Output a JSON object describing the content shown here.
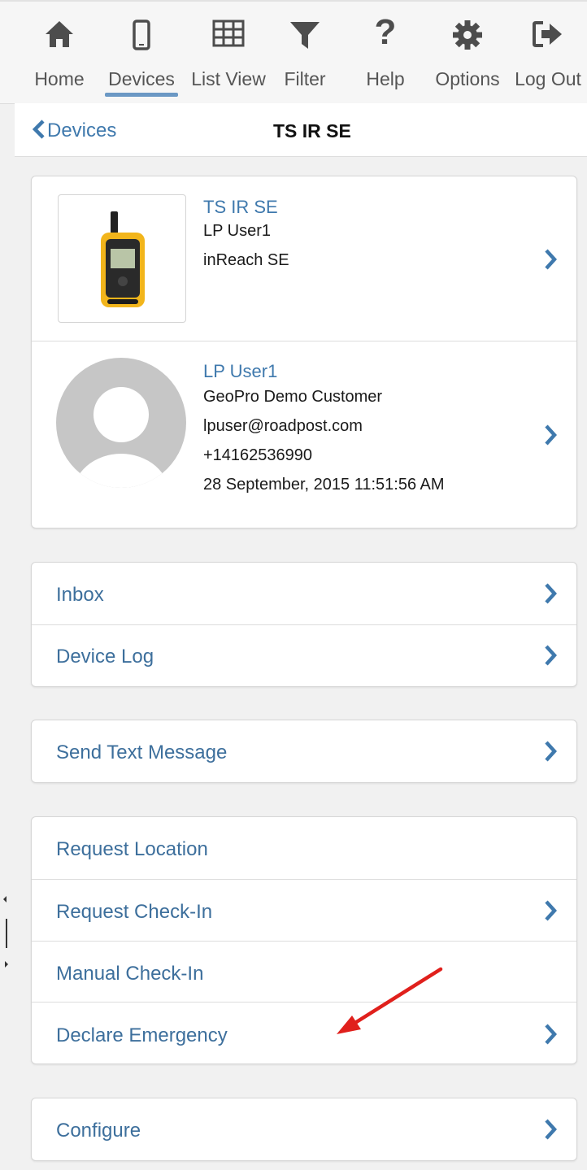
{
  "toolbar": {
    "items": [
      {
        "label": "Home",
        "icon": "home-icon"
      },
      {
        "label": "Devices",
        "icon": "phone-icon",
        "active": true
      },
      {
        "label": "List View",
        "icon": "table-icon"
      },
      {
        "label": "Filter",
        "icon": "filter-icon"
      },
      {
        "label": "Help",
        "icon": "help-icon"
      },
      {
        "label": "Options",
        "icon": "gear-icon"
      },
      {
        "label": "Log Out",
        "icon": "logout-icon"
      }
    ]
  },
  "navbar": {
    "back_label": "Devices",
    "title": "TS IR SE"
  },
  "device": {
    "name": "TS IR SE",
    "user": "LP User1",
    "model": "inReach SE"
  },
  "user": {
    "name": "LP User1",
    "customer": "GeoPro Demo Customer",
    "email": "lpuser@roadpost.com",
    "phone": "+14162536990",
    "timestamp": "28 September, 2015 11:51:56 AM"
  },
  "menu": {
    "inbox": "Inbox",
    "device_log": "Device Log",
    "send_text": "Send Text Message",
    "request_location": "Request Location",
    "request_checkin": "Request Check-In",
    "manual_checkin": "Manual Check-In",
    "declare_emergency": "Declare Emergency",
    "configure": "Configure"
  },
  "colors": {
    "accent": "#3f79ad",
    "link_text": "#3d6f9c",
    "annotation_arrow": "#e0201c",
    "device_body": "#f2b51b"
  }
}
